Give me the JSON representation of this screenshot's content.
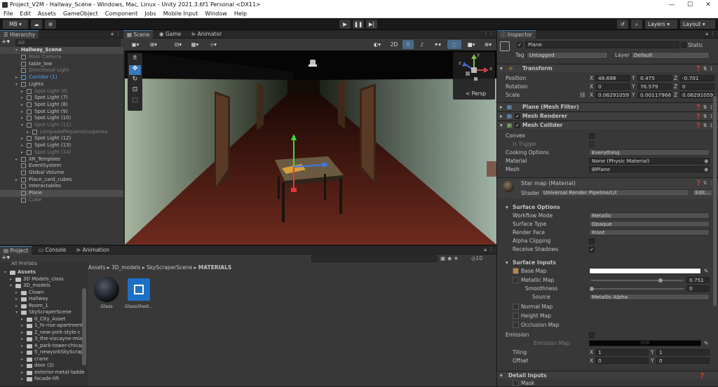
{
  "window": {
    "title": "Project_V2M - Hallway_Scene - Windows, Mac, Linux - Unity 2021.3.6f1 Personal <DX11>",
    "minimize_glyph": "—",
    "maximize_glyph": "☐",
    "close_glyph": "✕"
  },
  "menu": [
    "File",
    "Edit",
    "Assets",
    "GameObject",
    "Component",
    "Jobs",
    "Mobile Input",
    "Window",
    "Help"
  ],
  "toolbar": {
    "account": "MB ▾",
    "layers": "Layers",
    "layout": "Layout"
  },
  "hierarchy": {
    "tab": "Hierarchy",
    "search_placeholder": "All",
    "scene": "Hallway_Scene",
    "items": [
      {
        "label": "Main Camera",
        "dim": true,
        "indent": 1
      },
      {
        "label": "table_low",
        "indent": 1
      },
      {
        "label": "Directional Light",
        "dim": true,
        "indent": 1
      },
      {
        "label": "Corridor (1)",
        "blue": true,
        "indent": 1,
        "arrow": "▸"
      },
      {
        "label": "Lights",
        "indent": 1,
        "arrow": "▾"
      },
      {
        "label": "Spot Light (6)",
        "dim": true,
        "indent": 2,
        "arrow": "▸"
      },
      {
        "label": "Spot Light (7)",
        "indent": 2,
        "arrow": "▸"
      },
      {
        "label": "Spot Light (8)",
        "indent": 2,
        "arrow": "▸"
      },
      {
        "label": "Spot Light (9)",
        "indent": 2,
        "arrow": "▸"
      },
      {
        "label": "Spot Light (10)",
        "indent": 2,
        "arrow": "▸"
      },
      {
        "label": "Spot Light (11)",
        "dim": true,
        "indent": 2,
        "arrow": "▾"
      },
      {
        "label": "LampadaPequenaSuspensa",
        "dim": true,
        "indent": 3,
        "arrow": "▸"
      },
      {
        "label": "Spot Light (12)",
        "indent": 2,
        "arrow": "▸"
      },
      {
        "label": "Spot Light (13)",
        "indent": 2,
        "arrow": "▸"
      },
      {
        "label": "Spot Light (14)",
        "dim": true,
        "indent": 2,
        "arrow": "▸"
      },
      {
        "label": "XR_Template",
        "indent": 1,
        "arrow": "▸"
      },
      {
        "label": "EventSystem",
        "indent": 1
      },
      {
        "label": "Global Volume",
        "indent": 1
      },
      {
        "label": "Place_card_cubes",
        "indent": 1,
        "arrow": "▸"
      },
      {
        "label": "Interactables",
        "indent": 1
      },
      {
        "label": "Plane",
        "indent": 1,
        "selected": true
      },
      {
        "label": "Cube",
        "dim": true,
        "indent": 1
      }
    ]
  },
  "scene_tabs": [
    "Scene",
    "Game",
    "Animator"
  ],
  "scene_toolbar": {
    "mode_2d": "2D",
    "gizmo_count": "0"
  },
  "gizmo": {
    "persp_label": "< Persp",
    "axis_x": "x",
    "axis_y": "y",
    "axis_z": "z"
  },
  "project": {
    "tabs": [
      "Project",
      "Console",
      "Animation"
    ],
    "breadcrumb": [
      "Assets",
      "3D_models",
      "SkyScraperScene",
      "MATERIALS"
    ],
    "hidden_count": "10",
    "tree_top": "All Prefabs",
    "tree": [
      {
        "label": "Assets",
        "indent": 0,
        "arrow": "▾",
        "bold": true
      },
      {
        "label": "3D Models_class",
        "indent": 1,
        "arrow": "▸"
      },
      {
        "label": "3D_models",
        "indent": 1,
        "arrow": "▾"
      },
      {
        "label": "Clown",
        "indent": 2,
        "arrow": "▸"
      },
      {
        "label": "Hallway",
        "indent": 2,
        "arrow": "▸"
      },
      {
        "label": "Room_1",
        "indent": 2,
        "arrow": "▸"
      },
      {
        "label": "SkyScraperScene",
        "indent": 2,
        "arrow": "▾"
      },
      {
        "label": "0_City_Asset",
        "indent": 3,
        "arrow": "▸"
      },
      {
        "label": "1_hi-rise-apartment-",
        "indent": 3,
        "arrow": "▸"
      },
      {
        "label": "2_new-york-style-c",
        "indent": 3,
        "arrow": "▸"
      },
      {
        "label": "3_the-vizcayne-mia",
        "indent": 3,
        "arrow": "▸"
      },
      {
        "label": "4_park-tower-chicag",
        "indent": 3,
        "arrow": "▸"
      },
      {
        "label": "5_newyorkSkyScrap",
        "indent": 3,
        "arrow": "▸"
      },
      {
        "label": "crane",
        "indent": 3,
        "arrow": "▸"
      },
      {
        "label": "door (2)",
        "indent": 3,
        "arrow": "▸"
      },
      {
        "label": "exterior-metal-ladde",
        "indent": 3,
        "arrow": "▸"
      },
      {
        "label": "facade-lift",
        "indent": 3,
        "arrow": "▸"
      }
    ],
    "assets": [
      {
        "label": "Glass"
      },
      {
        "label": "GlassShed..."
      }
    ]
  },
  "inspector": {
    "tab": "Inspector",
    "object_name": "Plane",
    "static": "Static",
    "tag_label": "Tag",
    "tag": "Untagged",
    "layer_label": "Layer",
    "layer": "Default",
    "transform": {
      "title": "Transform",
      "position_label": "Position",
      "rotation_label": "Rotation",
      "scale_label": "Scale",
      "position": [
        "48.698",
        "0.475",
        "-0.701"
      ],
      "rotation": [
        "0",
        "76.579",
        "0"
      ],
      "scale": [
        "0.06291059",
        "0.001179667",
        "0.06291059"
      ],
      "axes": [
        "X",
        "Y",
        "Z"
      ]
    },
    "components": [
      {
        "title": "Plane (Mesh Filter)",
        "check": false
      },
      {
        "title": "Mesh Renderer",
        "check": true
      },
      {
        "title": "Mesh Collider",
        "check": true
      }
    ],
    "collider": {
      "convex_label": "Convex",
      "trigger_label": "Is Trigger",
      "cooking_label": "Cooking Options",
      "cooking": "Everything",
      "material_label": "Material",
      "material": "None (Physic Material)",
      "mesh_label": "Mesh",
      "mesh": "⊞Plane"
    },
    "material": {
      "name": "Star map (Material)",
      "shader_label": "Shader",
      "shader": "Universal Render Pipeline/Lit",
      "edit": "Edit..."
    },
    "surface_options": {
      "title": "Surface Options",
      "workflow_label": "Workflow Mode",
      "workflow": "Metallic",
      "type_label": "Surface Type",
      "type": "Opaque",
      "face_label": "Render Face",
      "face": "Front",
      "alpha_label": "Alpha Clipping",
      "shadows_label": "Receive Shadows"
    },
    "surface_inputs": {
      "title": "Surface Inputs",
      "base_label": "Base Map",
      "metallic_label": "Metallic Map",
      "metallic_value": "0.751",
      "metallic_fraction": 0.751,
      "smooth_label": "Smoothness",
      "smooth_value": "0",
      "source_label": "Source",
      "source": "Metallic Alpha",
      "normal_label": "Normal Map",
      "height_label": "Height Map",
      "occlusion_label": "Occlusion Map",
      "emission_label": "Emission",
      "emission_map_label": "Emission Map",
      "hdr": "HDR",
      "tiling_label": "Tiling",
      "tiling": [
        "1",
        "1"
      ],
      "offset_label": "Offset",
      "offset": [
        "0",
        "0"
      ],
      "xy": [
        "X",
        "Y"
      ]
    },
    "detail": {
      "title": "Detail Inputs",
      "mask": "Mask"
    }
  },
  "colors": {
    "accent": "#3a79bb",
    "selected_row": "#4d4d4d",
    "hierarchy_blue": "#4aa3ff"
  }
}
